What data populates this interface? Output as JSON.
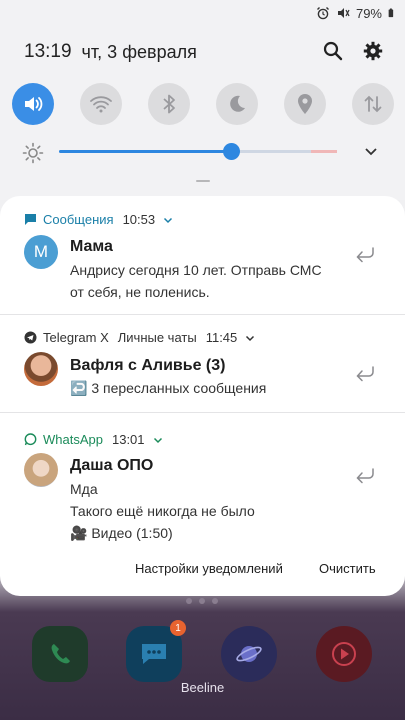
{
  "status_bar": {
    "alarm_icon": "alarm-icon",
    "mute_icon": "mute-icon",
    "battery_text": "79%",
    "battery_icon": "battery-icon"
  },
  "header": {
    "time": "13:19",
    "date": "чт, 3 февраля",
    "search_icon": "search-icon",
    "settings_icon": "gear-icon"
  },
  "quick_settings": {
    "toggles": [
      {
        "name": "sound",
        "icon": "volume-icon",
        "active": true
      },
      {
        "name": "wifi",
        "icon": "wifi-icon",
        "active": false
      },
      {
        "name": "bluetooth",
        "icon": "bluetooth-icon",
        "active": false
      },
      {
        "name": "night-mode",
        "icon": "moon-icon",
        "active": false
      },
      {
        "name": "location",
        "icon": "location-icon",
        "active": false
      },
      {
        "name": "data",
        "icon": "data-arrows-icon",
        "active": false
      }
    ],
    "brightness_level": 0.62,
    "accent_color": "#2d87e0"
  },
  "notifications": [
    {
      "app": "Сообщения",
      "time": "10:53",
      "app_color": "#1a7fa8",
      "sender": "Мама",
      "avatar_letter": "М",
      "lines": [
        "Андрису сегодня 10 лет. Отправь СМС",
        "от себя, не поленись."
      ]
    },
    {
      "app": "Telegram X",
      "subtitle": "Личные чаты",
      "time": "11:45",
      "app_color": "#333333",
      "sender": "Вафля с Аливье (3)",
      "lines": [
        "↩️ 3 пересланных сообщения"
      ]
    },
    {
      "app": "WhatsApp",
      "time": "13:01",
      "app_color": "#1b8b5a",
      "sender": "Даша ОПО",
      "lines": [
        "Мда",
        "Такого ещё никогда не было",
        "🎥 Видео (1:50)"
      ]
    }
  ],
  "actions": {
    "settings_label": "Настройки уведомлений",
    "clear_label": "Очистить"
  },
  "home": {
    "carrier": "Beeline",
    "messages_badge": "1"
  }
}
